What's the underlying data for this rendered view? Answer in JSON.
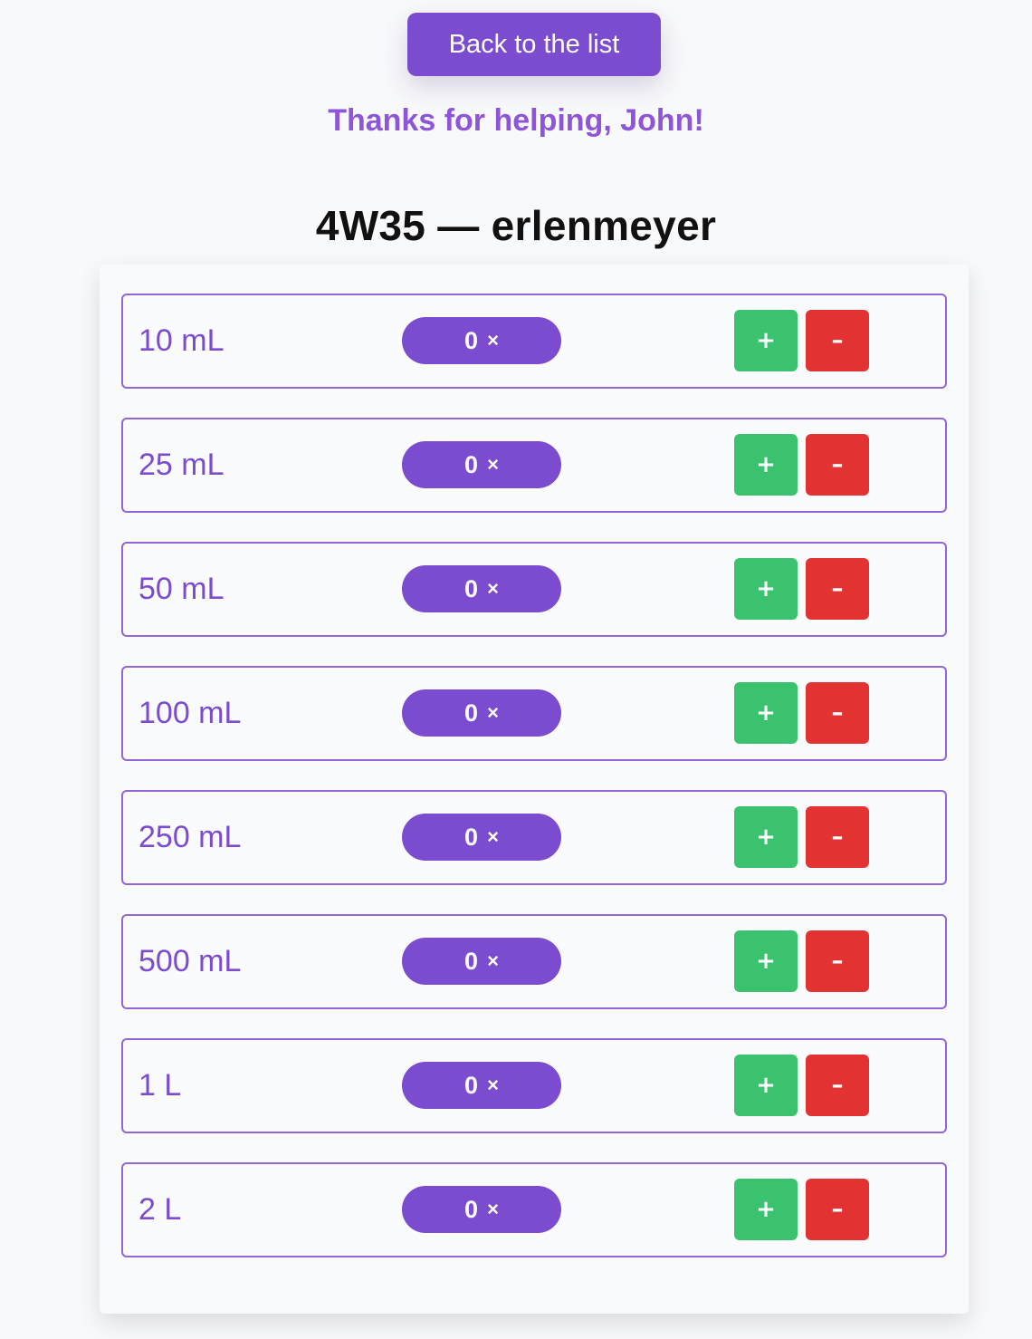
{
  "header": {
    "back_label": "Back to the list",
    "thanks_text": "Thanks for helping, John!",
    "title": "4W35 — erlenmeyer"
  },
  "items": [
    {
      "size": "10 mL",
      "count": "0",
      "times": "×",
      "plus": "+",
      "minus": "–"
    },
    {
      "size": "25 mL",
      "count": "0",
      "times": "×",
      "plus": "+",
      "minus": "–"
    },
    {
      "size": "50 mL",
      "count": "0",
      "times": "×",
      "plus": "+",
      "minus": "–"
    },
    {
      "size": "100 mL",
      "count": "0",
      "times": "×",
      "plus": "+",
      "minus": "–"
    },
    {
      "size": "250 mL",
      "count": "0",
      "times": "×",
      "plus": "+",
      "minus": "–"
    },
    {
      "size": "500 mL",
      "count": "0",
      "times": "×",
      "plus": "+",
      "minus": "–"
    },
    {
      "size": "1 L",
      "count": "0",
      "times": "×",
      "plus": "+",
      "minus": "–"
    },
    {
      "size": "2 L",
      "count": "0",
      "times": "×",
      "plus": "+",
      "minus": "–"
    }
  ],
  "colors": {
    "accent": "#7b4bd0",
    "thanks": "#8e55d8",
    "plus": "#3ac26e",
    "minus": "#e23232"
  }
}
